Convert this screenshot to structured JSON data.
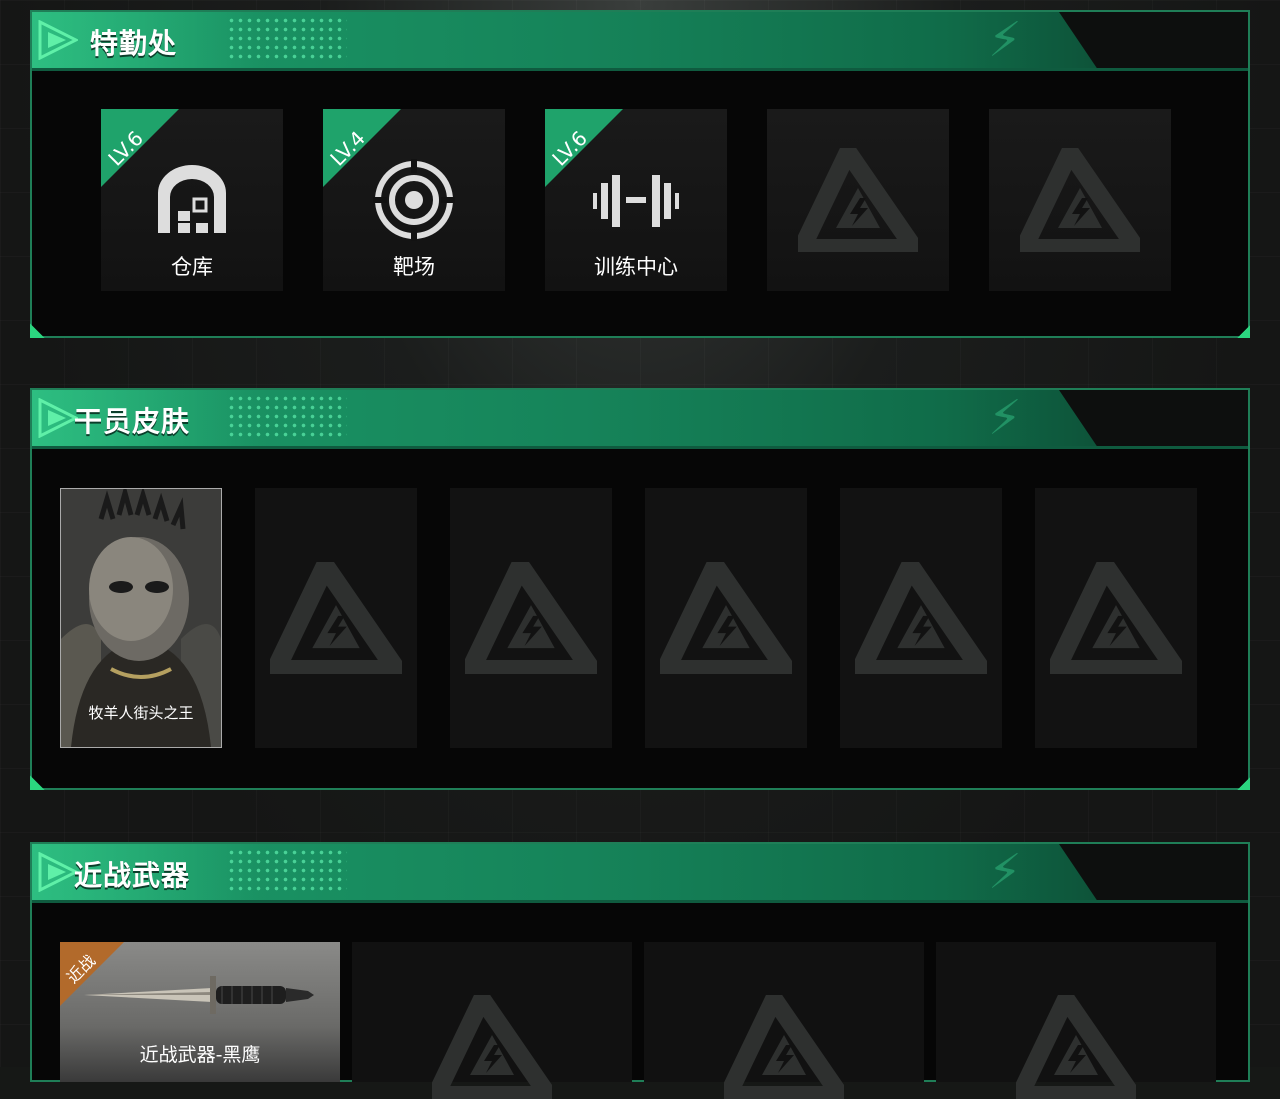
{
  "sections": {
    "tequchu": {
      "title": "特勤处",
      "facilities": [
        {
          "level": "LV.6",
          "name": "仓库",
          "icon": "warehouse-icon"
        },
        {
          "level": "LV.4",
          "name": "靶场",
          "icon": "target-icon"
        },
        {
          "level": "LV.6",
          "name": "训练中心",
          "icon": "dumbbell-icon"
        },
        {
          "icon": "placeholder-logo-icon"
        },
        {
          "icon": "placeholder-logo-icon"
        }
      ]
    },
    "skins": {
      "title": "干员皮肤",
      "items": [
        {
          "name": "牧羊人街头之王"
        }
      ]
    },
    "melee": {
      "title": "近战武器",
      "items": [
        {
          "tag": "近战",
          "name": "近战武器-黑鹰"
        }
      ]
    }
  },
  "colors": {
    "accent": "#1fa36b",
    "border": "#1f7e57",
    "melee_tag": "#b26a2b"
  }
}
